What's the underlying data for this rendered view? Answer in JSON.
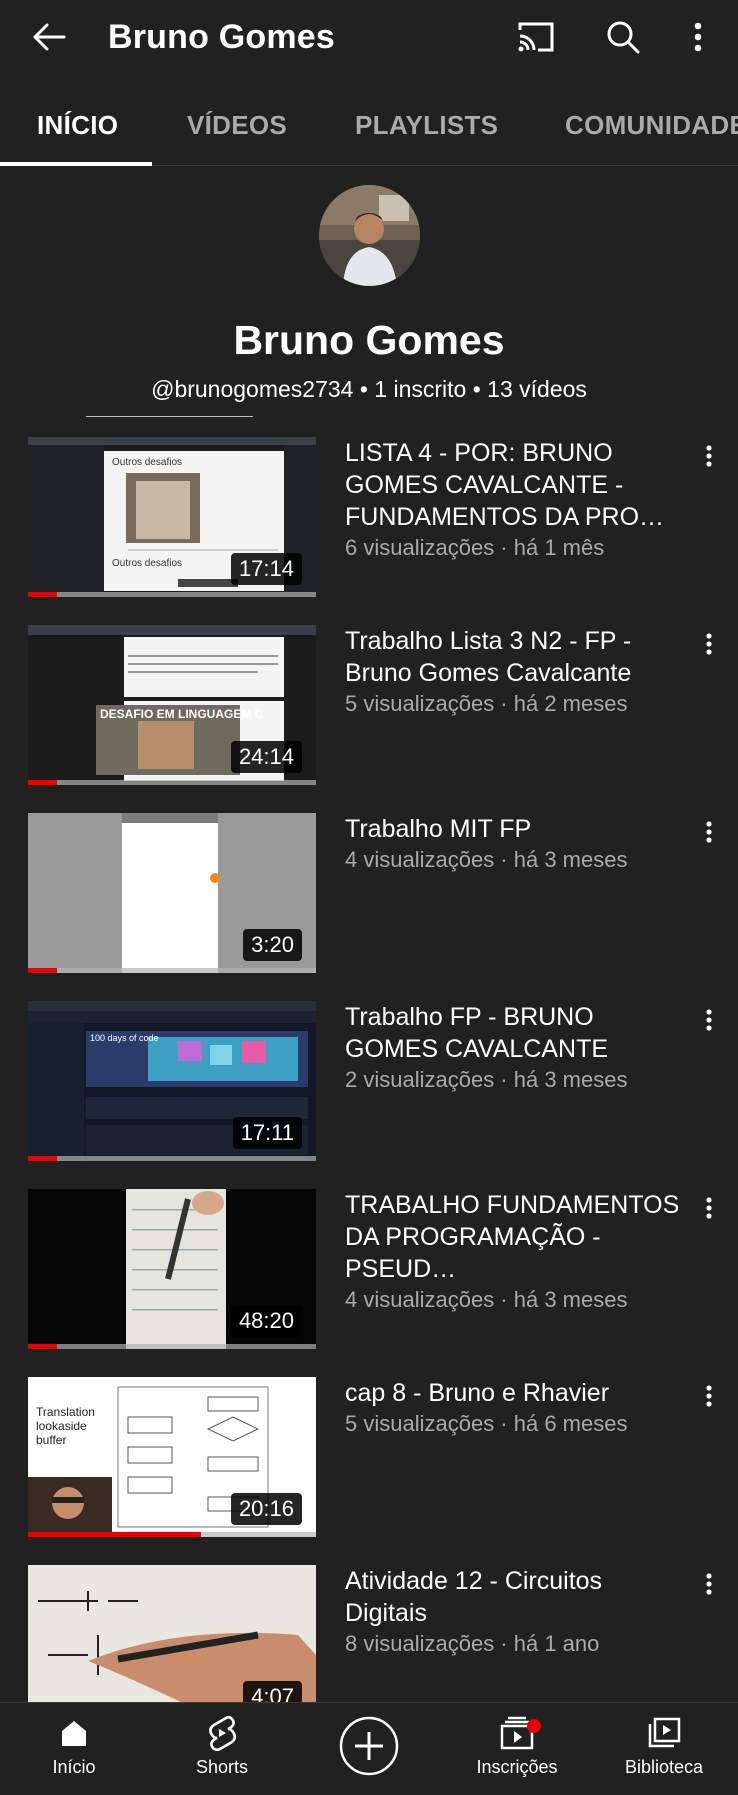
{
  "appbar": {
    "title": "Bruno Gomes",
    "icons": [
      "back-arrow-icon",
      "cast-icon",
      "search-icon",
      "more-vert-icon"
    ]
  },
  "tabs": [
    {
      "label": "INÍCIO",
      "active": true
    },
    {
      "label": "VÍDEOS",
      "active": false
    },
    {
      "label": "PLAYLISTS",
      "active": false
    },
    {
      "label": "COMUNIDADE",
      "active": false
    }
  ],
  "channel": {
    "name": "Bruno Gomes",
    "meta": "@brunogomes2734 • 1 inscrito • 13 vídeos"
  },
  "videos": [
    {
      "title": "LISTA 4 - POR: BRUNO GOMES CAVALCANTE - FUNDAMENTOS DA PRO…",
      "meta": "6 visualizações · há 1 mês",
      "duration": "17:14",
      "progress": 0.1
    },
    {
      "title": "Trabalho Lista 3 N2 - FP - Bruno Gomes Cavalcante",
      "meta": "5 visualizações · há 2 meses",
      "duration": "24:14",
      "progress": 0.1
    },
    {
      "title": "Trabalho MIT FP",
      "meta": "4 visualizações · há 3 meses",
      "duration": "3:20",
      "progress": 0.1
    },
    {
      "title": "Trabalho FP - BRUNO GOMES CAVALCANTE",
      "meta": "2 visualizações · há 3 meses",
      "duration": "17:11",
      "progress": 0.1
    },
    {
      "title": "TRABALHO FUNDAMENTOS DA PROGRAMAÇÃO - PSEUD…",
      "meta": "4 visualizações · há 3 meses",
      "duration": "48:20",
      "progress": 0.1
    },
    {
      "title": "cap 8 - Bruno e Rhavier",
      "meta": "5 visualizações · há 6 meses",
      "duration": "20:16",
      "progress": 0.6
    },
    {
      "title": "Atividade 12 - Circuitos Digitais",
      "meta": "8 visualizações · há 1 ano",
      "duration": "4:07",
      "progress": 0
    }
  ],
  "thumb_text": {
    "v1_heading": "Outros desafios",
    "v1_footer": "Outros desafios",
    "v2_caption": "DESAFIO EM LINGUAGEM C",
    "v4_banner": "100 days of code",
    "v6_text": "Translation lookaside buffer"
  },
  "bottomnav": [
    {
      "label": "Início",
      "icon": "home-icon",
      "active": true
    },
    {
      "label": "Shorts",
      "icon": "shorts-icon",
      "active": false
    },
    {
      "label": "",
      "icon": "create-plus-icon",
      "active": false
    },
    {
      "label": "Inscrições",
      "icon": "subscriptions-icon",
      "active": false,
      "badge": true
    },
    {
      "label": "Biblioteca",
      "icon": "library-icon",
      "active": false
    }
  ],
  "colors": {
    "background": "#212121",
    "accent_red": "#ee0000",
    "secondary_text": "#aaaaaa"
  }
}
